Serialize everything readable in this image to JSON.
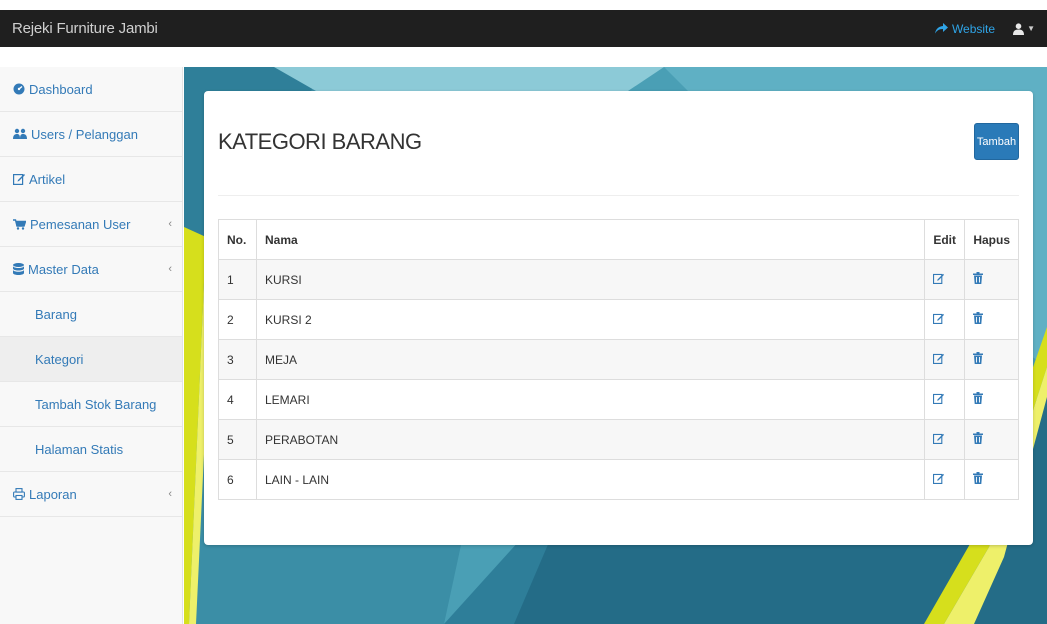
{
  "navbar": {
    "brand": "Rejeki Furniture Jambi",
    "website_label": "Website",
    "share_icon": "share-icon",
    "user_icon": "user-icon"
  },
  "sidebar": {
    "items": [
      {
        "label": "Dashboard",
        "icon": "dashboard-icon"
      },
      {
        "label": "Users / Pelanggan",
        "icon": "users-icon"
      },
      {
        "label": "Artikel",
        "icon": "edit-icon"
      },
      {
        "label": "Pemesanan User",
        "icon": "cart-icon",
        "arrow": "‹"
      },
      {
        "label": "Master Data",
        "icon": "database-icon",
        "arrow": "‹"
      },
      {
        "label": "Barang"
      },
      {
        "label": "Kategori",
        "active": true
      },
      {
        "label": "Tambah Stok Barang"
      },
      {
        "label": "Halaman Statis"
      },
      {
        "label": "Laporan",
        "icon": "print-icon",
        "arrow": "‹"
      }
    ]
  },
  "panel": {
    "title": "KATEGORI BARANG",
    "add_button": "Tambah"
  },
  "table": {
    "headers": [
      "No.",
      "Nama",
      "Edit",
      "Hapus"
    ],
    "rows": [
      {
        "no": "1",
        "nama": "KURSI"
      },
      {
        "no": "2",
        "nama": "KURSI 2"
      },
      {
        "no": "3",
        "nama": "MEJA"
      },
      {
        "no": "4",
        "nama": "LEMARI"
      },
      {
        "no": "5",
        "nama": "PERABOTAN"
      },
      {
        "no": "6",
        "nama": "LAIN - LAIN"
      }
    ]
  },
  "colors": {
    "accent": "#337ab7",
    "navbar": "#1f1f1f",
    "button": "#2a7ab8",
    "background_teal": "#4ea3b8",
    "stripe_yellow": "#d6df1c"
  }
}
